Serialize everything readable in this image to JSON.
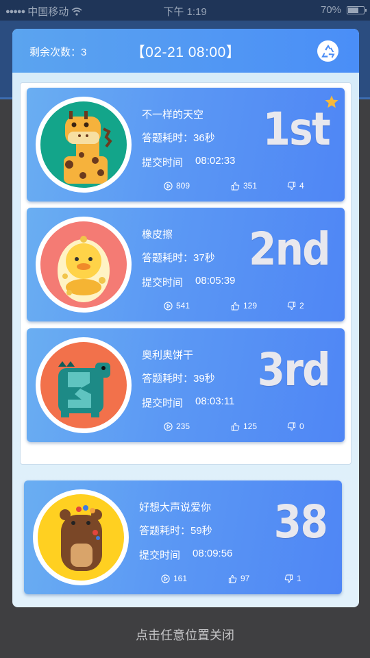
{
  "status_bar": {
    "carrier": "中国移动",
    "time": "下午 1:19",
    "battery_text": "70%",
    "battery_level": 0.7
  },
  "modal": {
    "remaining": "剩余次数：3",
    "datetime": "【02-21 08:00】",
    "refresh_icon": "recycle-icon"
  },
  "entries": [
    {
      "name": "不一样的天空",
      "duration": "答题耗时：36秒",
      "submit_label": "提交时间",
      "submit_time": "08:02:33",
      "rank": "1st",
      "plays": "809",
      "likes": "351",
      "dislikes": "4",
      "avatar": "giraffe",
      "avatar_bg": "#13a58a",
      "starred": true
    },
    {
      "name": "橡皮擦",
      "duration": "答题耗时：37秒",
      "submit_label": "提交时间",
      "submit_time": "08:05:39",
      "rank": "2nd",
      "plays": "541",
      "likes": "129",
      "dislikes": "2",
      "avatar": "duck",
      "avatar_bg": "#f47b74",
      "starred": false
    },
    {
      "name": "奥利奥饼干",
      "duration": "答题耗时：39秒",
      "submit_label": "提交时间",
      "submit_time": "08:03:11",
      "rank": "3rd",
      "plays": "235",
      "likes": "125",
      "dislikes": "0",
      "avatar": "dinosaur",
      "avatar_bg": "#f2714b",
      "starred": false
    }
  ],
  "my_entry": {
    "name": "好想大声说爱你",
    "duration": "答题耗时：59秒",
    "submit_label": "提交时间",
    "submit_time": "08:09:56",
    "rank": "38",
    "plays": "161",
    "likes": "97",
    "dislikes": "1",
    "avatar": "bear",
    "avatar_bg": "#ffd021"
  },
  "close_hint": "点击任意位置关闭",
  "colors": {
    "accent": "#4f8ef6",
    "rank_text": "#e8e8ee",
    "star": "#f6b93b"
  }
}
